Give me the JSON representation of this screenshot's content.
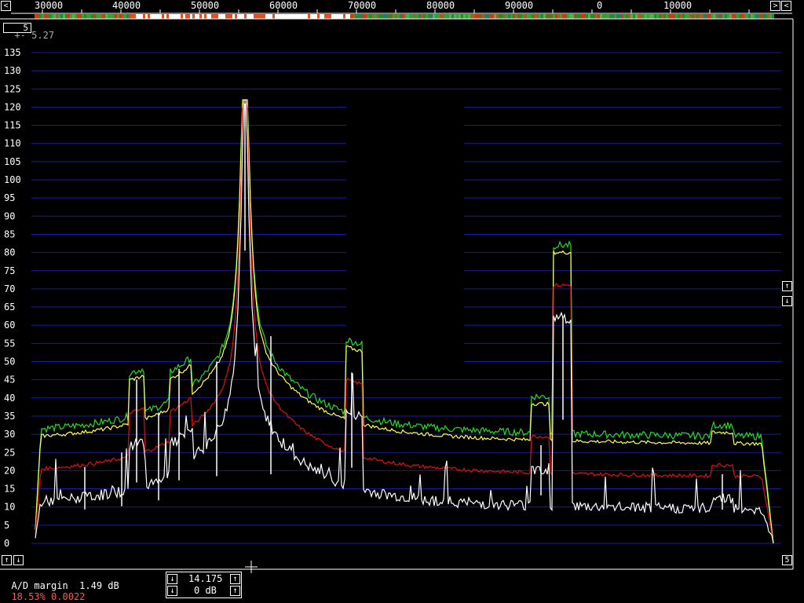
{
  "scale": {
    "left_button": "<",
    "right_buttons": [
      ">",
      "<"
    ],
    "freq_labels": [
      "30000",
      "40000",
      "50000",
      "60000",
      "70000",
      "80000",
      "90000",
      "0",
      "10000"
    ]
  },
  "header": {
    "cut_value": "5.27",
    "small_box": "5"
  },
  "y_axis": {
    "labels": [
      "135",
      "130",
      "125",
      "120",
      "115",
      "110",
      "105",
      "100",
      "95",
      "90",
      "85",
      "80",
      "75",
      "70",
      "65",
      "60",
      "55",
      "50",
      "45",
      "40",
      "35",
      "30",
      "25",
      "20",
      "15",
      "10",
      "5",
      "0"
    ]
  },
  "right_controls": {
    "up": "↑",
    "down": "↓",
    "box": "5"
  },
  "left_controls": {
    "up": "↑",
    "down": "↓"
  },
  "status": {
    "ad_margin_label": "A/D margin",
    "ad_margin_value": "1.49 dB",
    "percent": "18.53%",
    "value": "0.0022"
  },
  "center_box": {
    "freq_value": "14.175",
    "gain_value": "0 dB"
  },
  "colors": {
    "grid": "#1a1aa0",
    "green": "#22dd22",
    "yellow": "#ffff55",
    "red": "#dd1111",
    "white": "#ffffff",
    "status_red": "#ff5555"
  }
}
